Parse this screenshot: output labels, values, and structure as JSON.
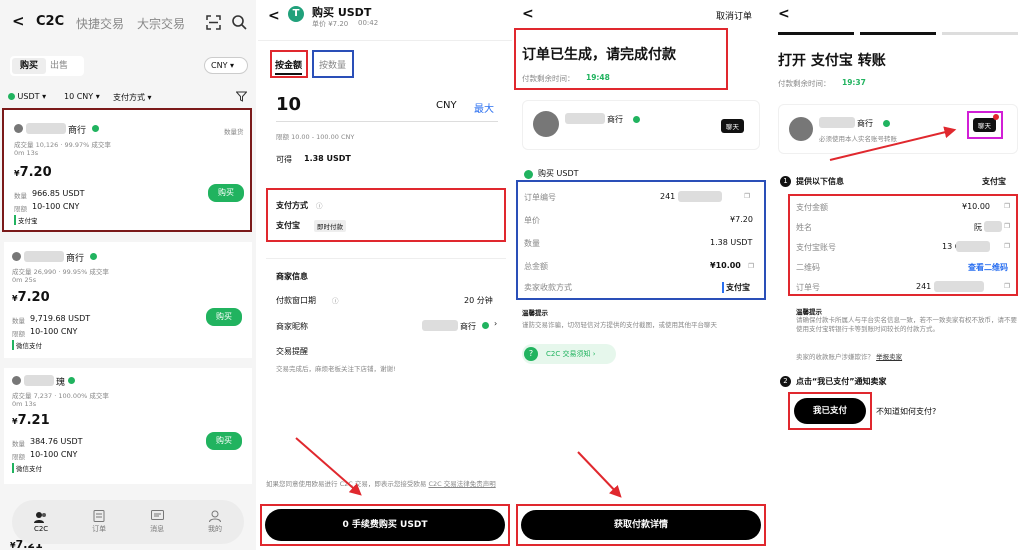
{
  "p1": {
    "back": "<",
    "tabs": [
      "C2C",
      "快捷交易",
      "大宗交易"
    ],
    "buy": "购买",
    "sell": "出售",
    "currency": "CNY",
    "filters": [
      "USDT",
      "10 CNY",
      "支付方式"
    ],
    "listings": [
      {
        "name": "商行",
        "stats": "成交量 10,126 · 99.97% 成交率",
        "time": "0m 13s",
        "badge": "数量货",
        "price": "7.20",
        "qty_label": "数量",
        "qty": "966.85 USDT",
        "lim_label": "限额",
        "lim": "10-100 CNY",
        "pay": "支付宝",
        "btn": "购买"
      },
      {
        "name": "商行",
        "stats": "成交量 26,990 · 99.95% 成交率",
        "time": "0m 25s",
        "badge": "",
        "price": "7.20",
        "qty_label": "数量",
        "qty": "9,719.68 USDT",
        "lim_label": "限额",
        "lim": "10-100 CNY",
        "pay": "微信支付",
        "btn": "购买"
      },
      {
        "name": "瑰",
        "stats": "成交量 7,237 · 100.00% 成交率",
        "time": "0m 13s",
        "badge": "",
        "price": "7.21",
        "qty_label": "数量",
        "qty": "384.76 USDT",
        "lim_label": "限额",
        "lim": "10-100 CNY",
        "pay": "微信支付",
        "btn": "购买"
      }
    ],
    "last_price": "7.21",
    "nav": [
      "C2C",
      "订单",
      "消息",
      "我的"
    ]
  },
  "p2": {
    "title": "购买 USDT",
    "sub": "单价 ¥7.20",
    "timer": "00:42",
    "tab_amount": "按金额",
    "tab_qty": "按数量",
    "amount": "10",
    "unit": "CNY",
    "max": "最大",
    "limit": "限额 10.00 - 100.00 CNY",
    "get_label": "可得",
    "get_val": "1.38 USDT",
    "pay_title": "支付方式",
    "pay_method": "支付宝",
    "pay_tag": "即时付款",
    "merchant_title": "商家信息",
    "window_label": "付款窗口期",
    "window_val": "20 分钟",
    "nick_label": "商家昵称",
    "nick_val": "商行",
    "remind_label": "交易提醒",
    "remind_text": "交易完成后，麻烦老板关注下店铺，谢谢!",
    "disclaimer1": "如果您同意使用欧易进行 C2C 交易，即表示您接受欧易",
    "disclaimer_link": "C2C 交易法律免责声明",
    "cta": "0 手续费购买 USDT"
  },
  "p3": {
    "back": "<",
    "cancel": "取消订单",
    "title": "订单已生成，请完成付款",
    "remain_label": "付款剩余时间：",
    "remain": "19:48",
    "name": "商行",
    "chat": "聊天",
    "buy": "购买 USDT",
    "rows": [
      {
        "k": "订单编号",
        "v": "241          991"
      },
      {
        "k": "单价",
        "v": "¥7.20"
      },
      {
        "k": "数量",
        "v": "1.38 USDT"
      },
      {
        "k": "总金额",
        "v": "¥10.00"
      },
      {
        "k": "卖家收款方式",
        "v": "支付宝"
      }
    ],
    "tip_title": "温馨提示",
    "tip": "谨防交易诈骗，切勿轻信对方提供的支付截图，或使用其他平台聊天",
    "guide": "C2C 交易须知",
    "cta": "获取付款详情"
  },
  "p4": {
    "back": "<",
    "title": "打开 支付宝 转账",
    "remain_label": "付款剩余时间：",
    "remain": "19:37",
    "name": "商行",
    "sub": "必须使用本人实名账号转账",
    "chat": "聊天",
    "step1": "提供以下信息",
    "step1_method": "支付宝",
    "rows": [
      {
        "k": "支付金额",
        "v": "¥10.00"
      },
      {
        "k": "姓名",
        "v": "阮"
      },
      {
        "k": "支付宝账号",
        "v": "13          6"
      },
      {
        "k": "二维码",
        "v": "查看二维码"
      },
      {
        "k": "订单号",
        "v": "241          991"
      }
    ],
    "tip_title": "温馨提示",
    "tip": "请确保付款卡所属人与平台实名信息一致，若不一致卖家有权不放币，请不要使用支付宝转银行卡等到账时间较长的付款方式。",
    "tip2": "卖家的收款账户涉嫌欺诈？",
    "tip2_link": "举报卖家",
    "step2": "点击“我已支付”通知卖家",
    "paid": "我已支付",
    "how": "不知道如何支付?"
  }
}
